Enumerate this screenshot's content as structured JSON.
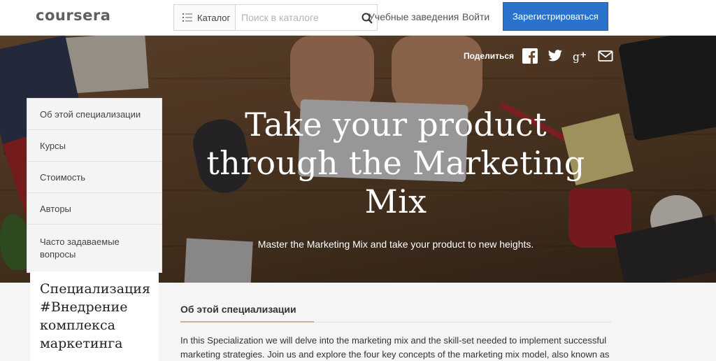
{
  "header": {
    "logo": "coursera",
    "catalog_label": "Каталог",
    "search_placeholder": "Поиск в каталоге",
    "nav_schools": "Учебные заведения",
    "nav_login": "Войти",
    "signup_label": "Зарегистрироваться"
  },
  "hero": {
    "share_label": "Поделиться",
    "share_icons": [
      "facebook-icon",
      "twitter-icon",
      "google-plus-icon",
      "mail-icon"
    ],
    "title": "Take your product through the Marketing Mix",
    "subtitle": "Master the Marketing Mix and take your product to new heights."
  },
  "sidebar": {
    "items": [
      {
        "label": "Об этой специализации"
      },
      {
        "label": "Курсы"
      },
      {
        "label": "Стоимость"
      },
      {
        "label": "Авторы"
      },
      {
        "label": "Часто задаваемые вопросы"
      }
    ],
    "spec_title": "Специализация #Внедрение комплекса маркетинга"
  },
  "main": {
    "section_heading": "Об этой специализации",
    "body": "In this Specialization we will delve into the marketing mix and the skill-set needed to implement successful marketing strategies. Join us and explore the four key concepts of the marketing mix model, also known as"
  },
  "colors": {
    "brand_blue": "#2a73cc",
    "accent_underline": "#c7b299",
    "logo_gray": "#5f5f5f"
  }
}
